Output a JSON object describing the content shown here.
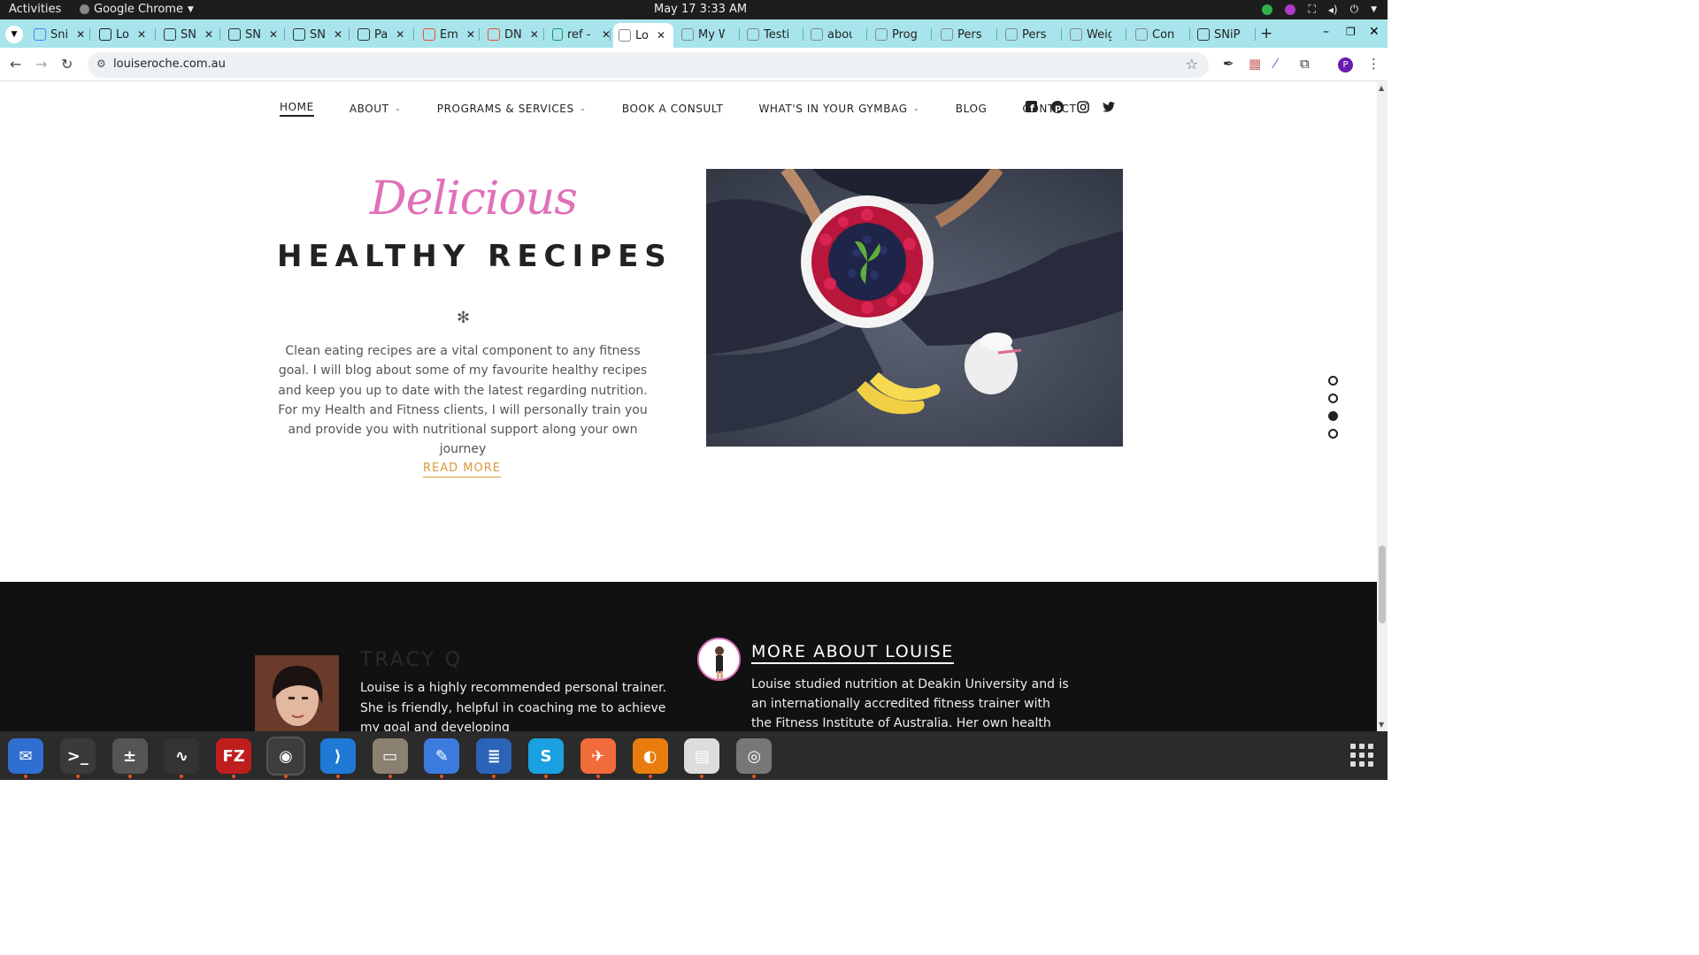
{
  "system": {
    "activities": "Activities",
    "app_name": "Google Chrome",
    "clock": "May 17  3:33 AM"
  },
  "tabs": [
    {
      "label": "Sni",
      "icon": "docs-icon",
      "color": "#4285f4"
    },
    {
      "label": "Lo",
      "icon": "letter-l-icon",
      "color": "#222"
    },
    {
      "label": "SN",
      "icon": "snip-icon",
      "color": "#333"
    },
    {
      "label": "SN",
      "icon": "snip-icon",
      "color": "#333"
    },
    {
      "label": "SN",
      "icon": "snip-icon",
      "color": "#333"
    },
    {
      "label": "Pa",
      "icon": "snip-icon",
      "color": "#333"
    },
    {
      "label": "Em",
      "icon": "orange-icon",
      "color": "#e8541e"
    },
    {
      "label": "DN",
      "icon": "orange-icon",
      "color": "#e8541e"
    },
    {
      "label": "ref - G",
      "icon": "sheets-icon",
      "color": "#0f9d58"
    },
    {
      "label": "Lo",
      "icon": "site-icon",
      "color": "#888",
      "active": true
    },
    {
      "label": "My W",
      "icon": "site-icon",
      "color": "#888"
    },
    {
      "label": "Testin",
      "icon": "site-icon",
      "color": "#888"
    },
    {
      "label": "about",
      "icon": "site-icon",
      "color": "#888"
    },
    {
      "label": "Progr",
      "icon": "site-icon",
      "color": "#888"
    },
    {
      "label": "Perso",
      "icon": "site-icon",
      "color": "#888"
    },
    {
      "label": "Perso",
      "icon": "site-icon",
      "color": "#888"
    },
    {
      "label": "Weigh",
      "icon": "site-icon",
      "color": "#888"
    },
    {
      "label": "Conta",
      "icon": "site-icon",
      "color": "#888"
    },
    {
      "label": "SNiP N",
      "icon": "snip-icon",
      "color": "#333"
    }
  ],
  "browser": {
    "url": "louiseroche.com.au",
    "profile_initial": "P"
  },
  "nav": {
    "home": "HOME",
    "about": "ABOUT",
    "programs": "PROGRAMS & SERVICES",
    "consult": "BOOK A CONSULT",
    "gymbag": "WHAT'S IN YOUR GYMBAG",
    "blog": "BLOG",
    "contact": "CONTACT"
  },
  "recipes": {
    "script_title": "Delicious",
    "title": "HEALTHY RECIPES",
    "divider": "✻",
    "body": "Clean eating recipes are a vital component to any fitness goal.  I will blog about some of my favourite healthy recipes and keep you up to date with the latest regarding nutrition.  For my Health and Fitness clients, I will personally train you and provide you with nutritional support along your own journey",
    "cta": "READ MORE"
  },
  "pager": {
    "count": 4,
    "active_index": 2
  },
  "testimonial": {
    "name": "TRACY Q",
    "text": "Louise is a highly recommended personal trainer. She is friendly, helpful in coaching me to achieve my goal and developing"
  },
  "about": {
    "heading": "MORE ABOUT LOUISE",
    "text": "Louise studied nutrition at Deakin University and is an internationally accredited fitness trainer with the Fitness Institute of Australia. Her own health journey"
  },
  "colors": {
    "tab_strip": "#a8e4ec",
    "accent_pink": "#e070b8",
    "accent_gold": "#d79a3a",
    "dark_band": "#111111"
  },
  "dock": [
    {
      "name": "thunderbird-icon",
      "glyph": "✉",
      "bg": "#2f6fd1"
    },
    {
      "name": "terminal-icon",
      "glyph": ">_",
      "bg": "#3a3a3a"
    },
    {
      "name": "calculator-icon",
      "glyph": "±",
      "bg": "#555"
    },
    {
      "name": "system-monitor-icon",
      "glyph": "∿",
      "bg": "#333"
    },
    {
      "name": "filezilla-icon",
      "glyph": "FZ",
      "bg": "#bf1e1e"
    },
    {
      "name": "chrome-icon",
      "glyph": "◉",
      "bg": "#444"
    },
    {
      "name": "vscode-icon",
      "glyph": "⟩",
      "bg": "#1e7ad6"
    },
    {
      "name": "files-icon",
      "glyph": "▭",
      "bg": "#8a8172"
    },
    {
      "name": "text-editor-icon",
      "glyph": "✎",
      "bg": "#3b7be0"
    },
    {
      "name": "writer-icon",
      "glyph": "≣",
      "bg": "#2b63b8"
    },
    {
      "name": "skype-icon",
      "glyph": "S",
      "bg": "#1ba1e2"
    },
    {
      "name": "postman-icon",
      "glyph": "✈",
      "bg": "#f26b3a"
    },
    {
      "name": "blender-icon",
      "glyph": "◐",
      "bg": "#e87d0d"
    },
    {
      "name": "screenshot-icon",
      "glyph": "▤",
      "bg": "#ddd"
    },
    {
      "name": "disks-icon",
      "glyph": "◎",
      "bg": "#777"
    }
  ]
}
